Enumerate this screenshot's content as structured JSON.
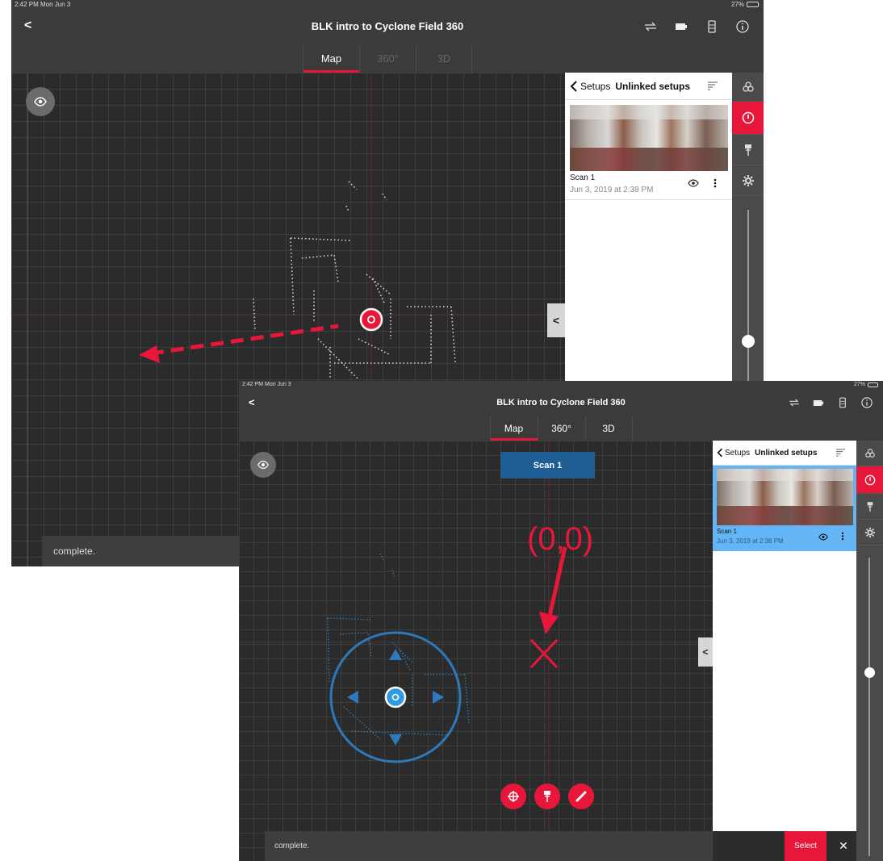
{
  "status_bar": {
    "time": "2:42 PM  Mon Jun 3",
    "battery": "27%"
  },
  "header": {
    "back_label": "<",
    "title": "BLK intro to Cyclone Field 360"
  },
  "tabs": [
    {
      "label": "Map",
      "active": true
    },
    {
      "label": "360°",
      "active": false
    },
    {
      "label": "3D",
      "active": false
    }
  ],
  "panel": {
    "back_label": "Setups",
    "heading": "Unlinked setups",
    "scan": {
      "name": "Scan 1",
      "date": "Jun 3, 2019 at 2:38 PM"
    }
  },
  "toast": {
    "message": "complete.",
    "select_label": "Select",
    "close_label": "✕"
  },
  "map_overlay": {
    "scan_label": "Scan 1",
    "origin_annotation": "(0,0)"
  },
  "collapse_label": "<",
  "icons": {
    "nav": [
      "swap-icon",
      "battery-icon",
      "scanner-icon",
      "info-icon"
    ],
    "rail": [
      "layers-icon",
      "compass-icon",
      "pin-icon",
      "settings-icon"
    ],
    "fabs": [
      "target-icon",
      "pin-icon",
      "measure-icon"
    ]
  },
  "colors": {
    "accent": "#e8173a",
    "selection": "#64b5f6",
    "scan_blue": "#1f5d95",
    "background": "#2c2c2c"
  }
}
